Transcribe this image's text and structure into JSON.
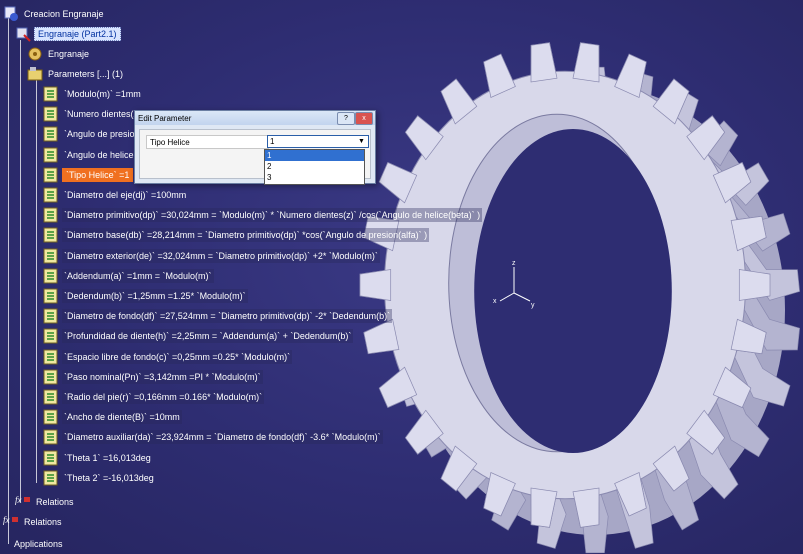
{
  "tree": {
    "root": "Creacion Engranaje",
    "part": "Engranaje (Part2.1)",
    "body": "Engranaje",
    "parameters": "Parameters [...] (1)",
    "params": [
      "`Modulo(m)` =1mm",
      "`Numero dientes(z",
      "`Angulo de presio",
      "`Angulo de helice",
      "`Tipo Helice` =1",
      "`Diametro del eje(dj)` =100mm",
      "`Diametro primitivo(dp)` =30,024mm = `Modulo(m)` * `Numero dientes(z)` /cos(`Angulo de helice(beta)` )",
      "`Diametro base(db)` =28,214mm = `Diametro primitivo(dp)` *cos(`Angulo de presion(alfa)` )",
      "`Diametro exterior(de)` =32,024mm = `Diametro primitivo(dp)` +2* `Modulo(m)`",
      "`Addendum(a)` =1mm = `Modulo(m)`",
      "`Dedendum(b)` =1,25mm =1.25* `Modulo(m)`",
      "`Diametro de fondo(df)` =27,524mm = `Diametro primitivo(dp)` -2* `Dedendum(b)`",
      "`Profundidad de diente(h)` =2,25mm = `Addendum(a)` + `Dedendum(b)`",
      "`Espacio libre de fondo(c)` =0,25mm =0.25* `Modulo(m)`",
      "`Paso nominal(Pn)` =3,142mm =PI * `Modulo(m)`",
      "`Radio del pie(r)` =0,166mm =0.166* `Modulo(m)`",
      "`Ancho de diente(B)` =10mm",
      "`Diametro auxiliar(da)` =23,924mm = `Diametro de fondo(df)` -3.6* `Modulo(m)`",
      "`Theta 1` =16,013deg",
      "`Theta 2` =-16,013deg"
    ],
    "relations_inner": "Relations",
    "relations_outer": "Relations",
    "applications": "Applications"
  },
  "dialog": {
    "title": "Edit Parameter",
    "help": "?",
    "close": "x",
    "param_name": "Tipo Helice",
    "value": "1",
    "options": [
      "1",
      "2",
      "3"
    ]
  },
  "axes": {
    "z": "z",
    "x": "x",
    "y": "y"
  },
  "colors": {
    "background": "#2e2d72",
    "gear": "#cfcfe4",
    "highlight": "#f07020",
    "selection": "#3070d0"
  }
}
